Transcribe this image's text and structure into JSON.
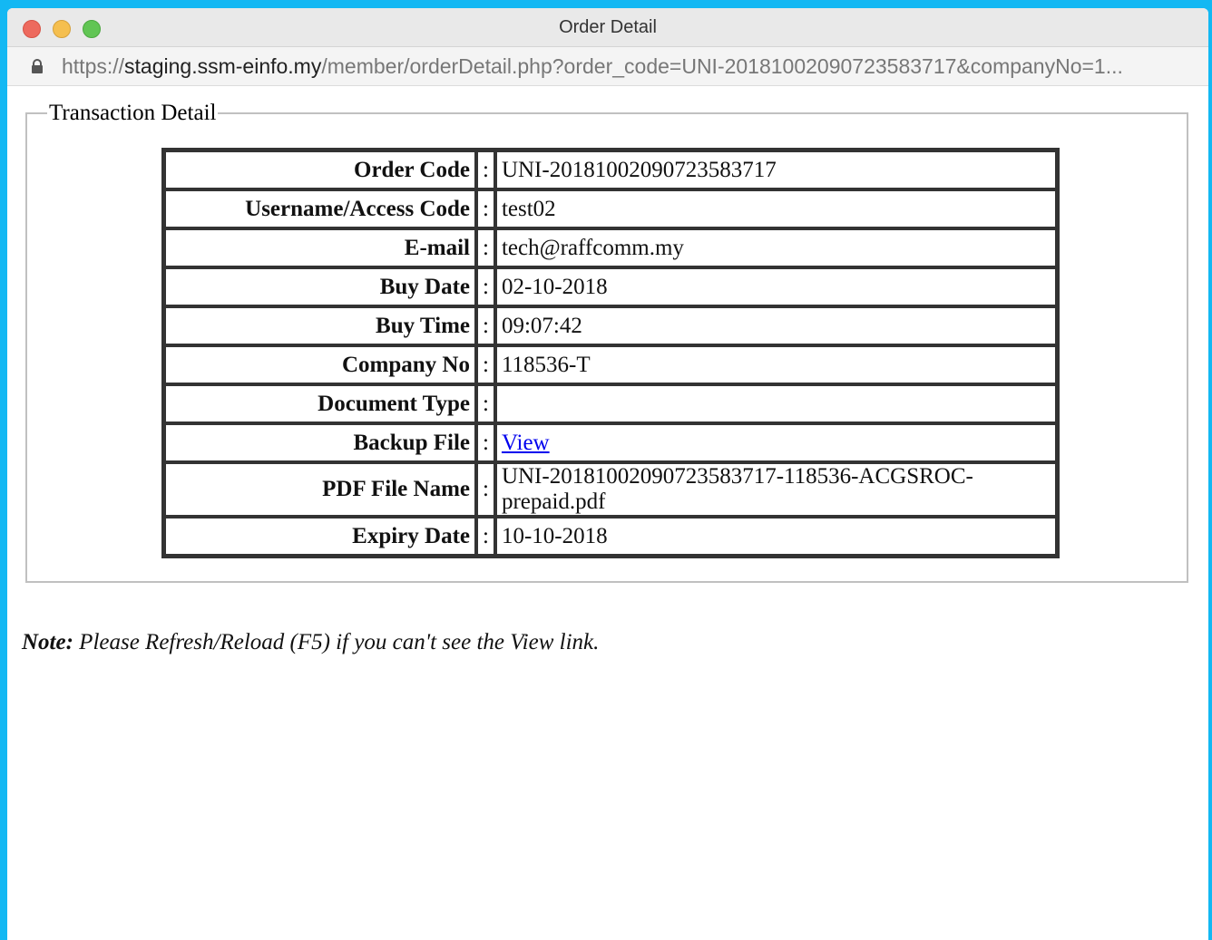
{
  "window": {
    "title": "Order Detail",
    "url_scheme": "https://",
    "url_host": "staging.ssm-einfo.my",
    "url_path": "/member/orderDetail.php?order_code=UNI-20181002090723583717&companyNo=1..."
  },
  "transaction": {
    "legend": "Transaction Detail",
    "separator": ":",
    "rows": [
      {
        "label": "Order Code",
        "value": "UNI-20181002090723583717"
      },
      {
        "label": "Username/Access Code",
        "value": "test02"
      },
      {
        "label": "E-mail",
        "value": "tech@raffcomm.my"
      },
      {
        "label": "Buy Date",
        "value": "02-10-2018"
      },
      {
        "label": "Buy Time",
        "value": "09:07:42"
      },
      {
        "label": "Company No",
        "value": "118536-T"
      },
      {
        "label": "Document Type",
        "value": ""
      },
      {
        "label": "Backup File",
        "value": "View"
      },
      {
        "label": "PDF File Name",
        "value": "UNI-20181002090723583717-118536-ACGSROC-prepaid.pdf"
      },
      {
        "label": "Expiry Date",
        "value": "10-10-2018"
      }
    ]
  },
  "note": {
    "prefix": "Note:",
    "text": " Please Refresh/Reload (F5) if you can't see the View link."
  }
}
